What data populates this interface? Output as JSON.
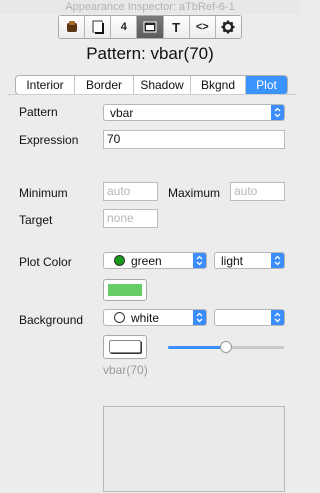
{
  "window": {
    "title": "Appearance Inspector: aTbRef-6-1"
  },
  "toolbar": {
    "buttons": [
      {
        "name": "properties",
        "icon": "properties-icon"
      },
      {
        "name": "text",
        "icon": "text-icon"
      },
      {
        "name": "quickstamp",
        "icon": "quickstamp-icon",
        "label": "4"
      },
      {
        "name": "appearance",
        "icon": "appearance-icon",
        "active": true
      },
      {
        "name": "text-format",
        "icon": "text-format-icon",
        "label": "T"
      },
      {
        "name": "action",
        "icon": "action-icon",
        "label": "<>"
      },
      {
        "name": "settings",
        "icon": "gear-icon"
      }
    ]
  },
  "heading": "Pattern: vbar(70)",
  "tabs": [
    {
      "label": "Interior"
    },
    {
      "label": "Border"
    },
    {
      "label": "Shadow"
    },
    {
      "label": "Bkgnd"
    },
    {
      "label": "Plot",
      "active": true
    }
  ],
  "form": {
    "pattern_label": "Pattern",
    "pattern_value": "vbar",
    "expression_label": "Expression",
    "expression_value": "70",
    "minimum_label": "Minimum",
    "minimum_placeholder": "auto",
    "maximum_label": "Maximum",
    "maximum_placeholder": "auto",
    "target_label": "Target",
    "target_placeholder": "none",
    "plot_color_label": "Plot Color",
    "plot_color_value": "green",
    "plot_color_hex": "#1a9a1a",
    "plot_color_shade": "light",
    "plot_swatch_hex": "#66cc66",
    "background_label": "Background",
    "background_value": "white",
    "background_shade": "",
    "opacity_fraction": 0.5,
    "preview_caption": "vbar(70)"
  },
  "colors": {
    "accent": "#3b8dfd",
    "tab_active": "#3b93ff"
  }
}
